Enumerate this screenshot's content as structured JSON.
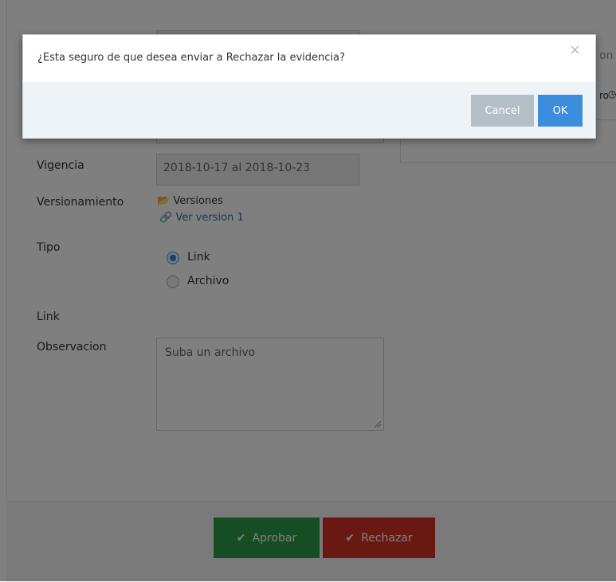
{
  "form": {
    "vigencia_label": "Vigencia",
    "vigencia_value": "2018-10-17 al 2018-10-23",
    "versionamiento_label": "Versionamiento",
    "versiones_text": "Versiones",
    "ver_version_text": "Ver version 1",
    "tipo_label": "Tipo",
    "tipo_options": [
      "Link",
      "Archivo"
    ],
    "tipo_selected": "Link",
    "link_label": "Link",
    "observacion_label": "Observacion",
    "observacion_value": "Suba un archivo",
    "right_clip_top": "on",
    "right_clip_mid": "ro"
  },
  "footer": {
    "approve_label": "Aprobar",
    "reject_label": "Rechazar"
  },
  "modal": {
    "message": "¿Esta seguro de que desea enviar a Rechazar la evidencia?",
    "close_symbol": "×",
    "cancel_label": "Cancel",
    "ok_label": "OK"
  },
  "colors": {
    "approve": "#2f9a45",
    "reject": "#d23325",
    "ok": "#3c8ddc",
    "cancel": "#b4bfc8",
    "overlay": "rgba(0,0,0,0.5)"
  },
  "icons": [
    "folder-open-icon",
    "link-icon",
    "check-icon",
    "close-icon",
    "clock-icon"
  ]
}
